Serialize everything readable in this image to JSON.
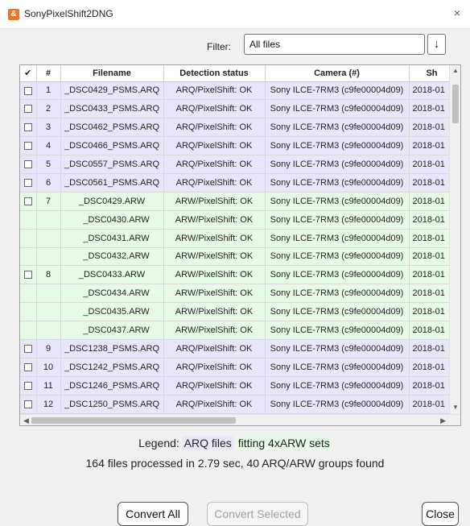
{
  "window": {
    "title": "SonyPixelShift2DNG",
    "icon": "app-icon",
    "close": "×"
  },
  "filter": {
    "label": "Filter:",
    "value": "All files",
    "arrow": "↓"
  },
  "table": {
    "headers": [
      "✔",
      "#",
      "Filename",
      "Detection status",
      "Camera (#)",
      "Sh"
    ],
    "rows": [
      {
        "type": "arq",
        "checkbox": true,
        "num": "1",
        "filename": "_DSC0429_PSMS.ARQ",
        "status": "ARQ/PixelShift: OK",
        "camera": "Sony ILCE-7RM3 (c9fe00004d09)",
        "shot": "2018-01"
      },
      {
        "type": "arq",
        "checkbox": true,
        "num": "2",
        "filename": "_DSC0433_PSMS.ARQ",
        "status": "ARQ/PixelShift: OK",
        "camera": "Sony ILCE-7RM3 (c9fe00004d09)",
        "shot": "2018-01"
      },
      {
        "type": "arq",
        "checkbox": true,
        "num": "3",
        "filename": "_DSC0462_PSMS.ARQ",
        "status": "ARQ/PixelShift: OK",
        "camera": "Sony ILCE-7RM3 (c9fe00004d09)",
        "shot": "2018-01"
      },
      {
        "type": "arq",
        "checkbox": true,
        "num": "4",
        "filename": "_DSC0466_PSMS.ARQ",
        "status": "ARQ/PixelShift: OK",
        "camera": "Sony ILCE-7RM3 (c9fe00004d09)",
        "shot": "2018-01"
      },
      {
        "type": "arq",
        "checkbox": true,
        "num": "5",
        "filename": "_DSC0557_PSMS.ARQ",
        "status": "ARQ/PixelShift: OK",
        "camera": "Sony ILCE-7RM3 (c9fe00004d09)",
        "shot": "2018-01"
      },
      {
        "type": "arq",
        "checkbox": true,
        "num": "6",
        "filename": "_DSC0561_PSMS.ARQ",
        "status": "ARQ/PixelShift: OK",
        "camera": "Sony ILCE-7RM3 (c9fe00004d09)",
        "shot": "2018-01"
      },
      {
        "type": "arw",
        "checkbox": true,
        "num": "7",
        "filename": "_DSC0429.ARW",
        "status": "ARW/PixelShift: OK",
        "camera": "Sony ILCE-7RM3 (c9fe00004d09)",
        "shot": "2018-01"
      },
      {
        "type": "arw",
        "checkbox": false,
        "num": "",
        "filename": "_DSC0430.ARW",
        "status": "ARW/PixelShift: OK",
        "camera": "Sony ILCE-7RM3 (c9fe00004d09)",
        "shot": "2018-01"
      },
      {
        "type": "arw",
        "checkbox": false,
        "num": "",
        "filename": "_DSC0431.ARW",
        "status": "ARW/PixelShift: OK",
        "camera": "Sony ILCE-7RM3 (c9fe00004d09)",
        "shot": "2018-01"
      },
      {
        "type": "arw",
        "checkbox": false,
        "num": "",
        "filename": "_DSC0432.ARW",
        "status": "ARW/PixelShift: OK",
        "camera": "Sony ILCE-7RM3 (c9fe00004d09)",
        "shot": "2018-01"
      },
      {
        "type": "arw",
        "checkbox": true,
        "num": "8",
        "filename": "_DSC0433.ARW",
        "status": "ARW/PixelShift: OK",
        "camera": "Sony ILCE-7RM3 (c9fe00004d09)",
        "shot": "2018-01"
      },
      {
        "type": "arw",
        "checkbox": false,
        "num": "",
        "filename": "_DSC0434.ARW",
        "status": "ARW/PixelShift: OK",
        "camera": "Sony ILCE-7RM3 (c9fe00004d09)",
        "shot": "2018-01"
      },
      {
        "type": "arw",
        "checkbox": false,
        "num": "",
        "filename": "_DSC0435.ARW",
        "status": "ARW/PixelShift: OK",
        "camera": "Sony ILCE-7RM3 (c9fe00004d09)",
        "shot": "2018-01"
      },
      {
        "type": "arw",
        "checkbox": false,
        "num": "",
        "filename": "_DSC0437.ARW",
        "status": "ARW/PixelShift: OK",
        "camera": "Sony ILCE-7RM3 (c9fe00004d09)",
        "shot": "2018-01"
      },
      {
        "type": "arq",
        "checkbox": true,
        "num": "9",
        "filename": "_DSC1238_PSMS.ARQ",
        "status": "ARQ/PixelShift: OK",
        "camera": "Sony ILCE-7RM3 (c9fe00004d09)",
        "shot": "2018-01"
      },
      {
        "type": "arq",
        "checkbox": true,
        "num": "10",
        "filename": "_DSC1242_PSMS.ARQ",
        "status": "ARQ/PixelShift: OK",
        "camera": "Sony ILCE-7RM3 (c9fe00004d09)",
        "shot": "2018-01"
      },
      {
        "type": "arq",
        "checkbox": true,
        "num": "11",
        "filename": "_DSC1246_PSMS.ARQ",
        "status": "ARQ/PixelShift: OK",
        "camera": "Sony ILCE-7RM3 (c9fe00004d09)",
        "shot": "2018-01"
      },
      {
        "type": "arq",
        "checkbox": true,
        "num": "12",
        "filename": "_DSC1250_PSMS.ARQ",
        "status": "ARQ/PixelShift: OK",
        "camera": "Sony ILCE-7RM3 (c9fe00004d09)",
        "shot": "2018-01"
      }
    ]
  },
  "scrollbars": {
    "up": "▲",
    "down": "▼",
    "left": "◀",
    "right": "▶"
  },
  "legend": {
    "label": "Legend:",
    "arq": "ARQ files",
    "middle": " ",
    "arw": "fitting 4xARW sets"
  },
  "status_text": "164 files processed in 2.79 sec, 40 ARQ/ARW groups found",
  "buttons": {
    "convert_all": "Convert All",
    "convert_selected": "Convert Selected",
    "close": "Close"
  },
  "colors": {
    "arq_row": "#e8e6fb",
    "arw_row": "#e6fbe6",
    "app_icon": "#e8742a"
  }
}
